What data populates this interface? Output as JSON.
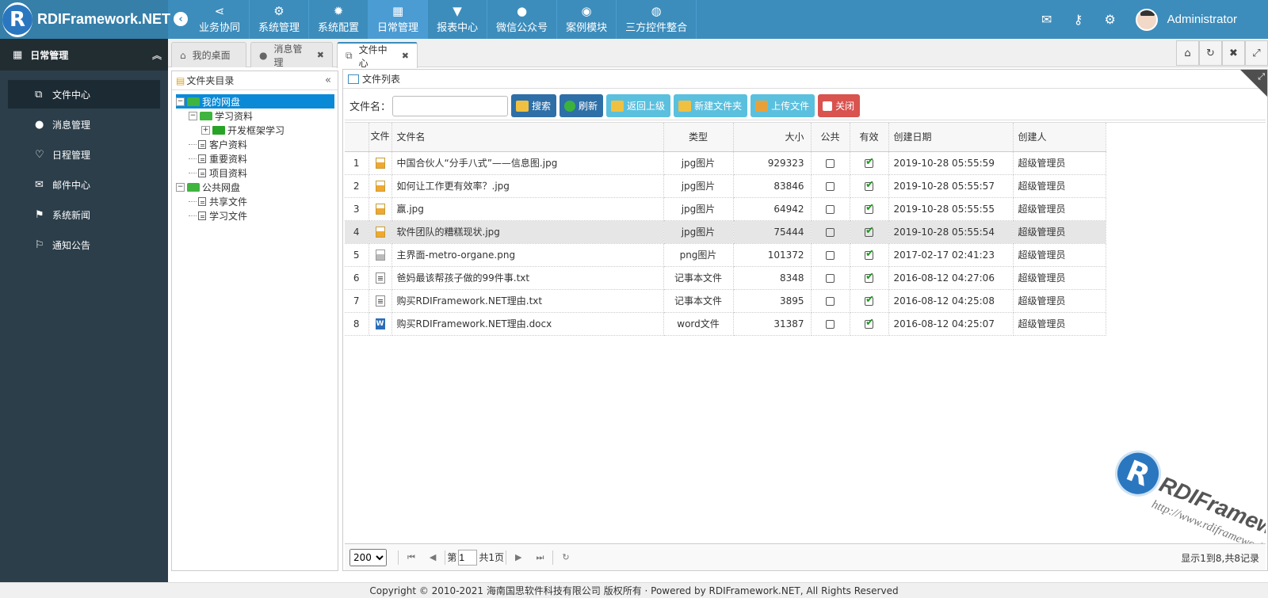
{
  "brand": {
    "logo_letter": "R",
    "name": "RDIFramework.NET"
  },
  "topnav": [
    {
      "icon": "share-icon",
      "glyph": "⋖",
      "label": "业务协同"
    },
    {
      "icon": "gears-icon",
      "glyph": "⚙",
      "label": "系统管理"
    },
    {
      "icon": "cog-icon",
      "glyph": "✹",
      "label": "系统配置"
    },
    {
      "icon": "calendar-icon",
      "glyph": "▦",
      "label": "日常管理",
      "active": true
    },
    {
      "icon": "glass-icon",
      "glyph": "▼",
      "label": "报表中心"
    },
    {
      "icon": "wechat-icon",
      "glyph": "●",
      "label": "微信公众号"
    },
    {
      "icon": "eye-icon",
      "glyph": "◉",
      "label": "案例模块"
    },
    {
      "icon": "globe-icon",
      "glyph": "◍",
      "label": "三方控件整合"
    }
  ],
  "user": {
    "name": "Administrator"
  },
  "sidebar": {
    "title": "日常管理",
    "items": [
      {
        "label": "文件中心",
        "glyph": "⧉",
        "active": true
      },
      {
        "label": "消息管理",
        "glyph": "●"
      },
      {
        "label": "日程管理",
        "glyph": "♡"
      },
      {
        "label": "邮件中心",
        "glyph": "✉"
      },
      {
        "label": "系统新闻",
        "glyph": "⚑"
      },
      {
        "label": "通知公告",
        "glyph": "⚐"
      }
    ]
  },
  "tabs": [
    {
      "label": "我的桌面",
      "glyph": "⌂"
    },
    {
      "label": "消息管理",
      "glyph": "●",
      "closable": true
    },
    {
      "label": "文件中心",
      "glyph": "⧉",
      "closable": true,
      "active": true
    }
  ],
  "folder_panel": {
    "title": "文件夹目录",
    "tree": [
      {
        "label": "我的网盘",
        "level": 0,
        "selected": true
      },
      {
        "label": "学习资料",
        "level": 1
      },
      {
        "label": "开发框架学习",
        "level": 2
      },
      {
        "label": "客户资料",
        "level": 1
      },
      {
        "label": "重要资料",
        "level": 1
      },
      {
        "label": "项目资料",
        "level": 1
      },
      {
        "label": "公共网盘",
        "level": 0
      },
      {
        "label": "共享文件",
        "level": 1
      },
      {
        "label": "学习文件",
        "level": 1
      }
    ]
  },
  "list_panel": {
    "title": "文件列表",
    "search_label": "文件名：",
    "search_value": "",
    "buttons": {
      "search": "搜索",
      "refresh": "刷新",
      "back": "返回上级",
      "new_folder": "新建文件夹",
      "upload": "上传文件",
      "close": "关闭"
    },
    "columns": [
      "文件",
      "文件名",
      "类型",
      "大小",
      "公共",
      "有效",
      "创建日期",
      "创建人"
    ],
    "rows": [
      {
        "num": "1",
        "kind": "jpg",
        "name": "中国合伙人“分手八式”——信息图.jpg",
        "type": "jpg图片",
        "size": "929323",
        "date": "2019-10-28 05:55:59",
        "creator": "超级管理员"
      },
      {
        "num": "2",
        "kind": "jpg",
        "name": "如何让工作更有效率？.jpg",
        "type": "jpg图片",
        "size": "83846",
        "date": "2019-10-28 05:55:57",
        "creator": "超级管理员"
      },
      {
        "num": "3",
        "kind": "jpg",
        "name": "赢.jpg",
        "type": "jpg图片",
        "size": "64942",
        "date": "2019-10-28 05:55:55",
        "creator": "超级管理员"
      },
      {
        "num": "4",
        "kind": "jpg",
        "name": "软件团队的糟糕现状.jpg",
        "type": "jpg图片",
        "size": "75444",
        "date": "2019-10-28 05:55:54",
        "creator": "超级管理员",
        "highlight": true
      },
      {
        "num": "5",
        "kind": "png",
        "name": "主界面-metro-organe.png",
        "type": "png图片",
        "size": "101372",
        "date": "2017-02-17 02:41:23",
        "creator": "超级管理员"
      },
      {
        "num": "6",
        "kind": "txt",
        "name": "爸妈最该帮孩子做的99件事.txt",
        "type": "记事本文件",
        "size": "8348",
        "date": "2016-08-12 04:27:06",
        "creator": "超级管理员"
      },
      {
        "num": "7",
        "kind": "txt",
        "name": "购买RDIFramework.NET理由.txt",
        "type": "记事本文件",
        "size": "3895",
        "date": "2016-08-12 04:25:08",
        "creator": "超级管理员"
      },
      {
        "num": "8",
        "kind": "doc",
        "name": "购买RDIFramework.NET理由.docx",
        "type": "word文件",
        "size": "31387",
        "date": "2016-08-12 04:25:07",
        "creator": "超级管理员"
      }
    ],
    "watermark": {
      "letter": "R",
      "name": "RDIFramework.NET",
      "url": "http://www.rdiframework.net/"
    },
    "pager": {
      "page_size": "200",
      "page_prefix": "第",
      "page_value": "1",
      "page_suffix": "共1页",
      "info": "显示1到8,共8记录"
    }
  },
  "footer": "Copyright © 2010-2021 海南国思软件科技有限公司 版权所有 · Powered by RDIFramework.NET, All Rights Reserved",
  "colors": {
    "header": "#3c8dbc",
    "sidebar": "#2b3e4a",
    "tree_selected": "#0a8ad6"
  }
}
